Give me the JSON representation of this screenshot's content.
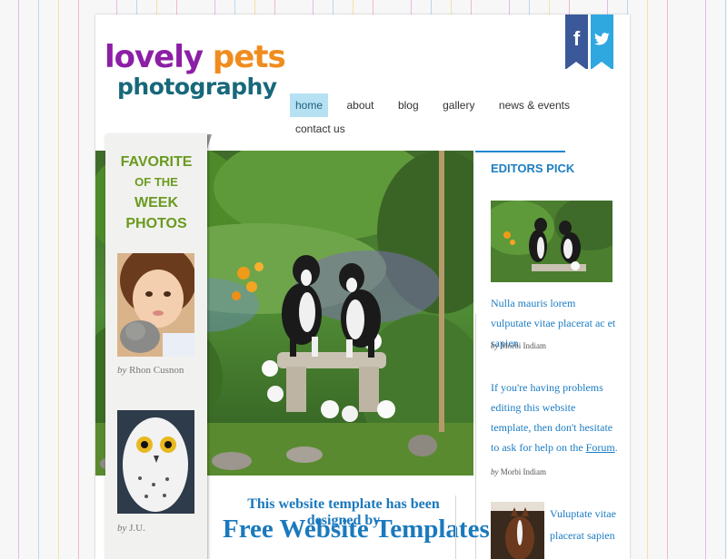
{
  "logo": {
    "word1": "lovely",
    "word2": "pets",
    "line2": "photography"
  },
  "social": {
    "facebook": "f",
    "twitter": "🐦"
  },
  "nav": {
    "items": [
      "home",
      "about",
      "blog",
      "gallery",
      "news & events",
      "contact us"
    ],
    "active": "home"
  },
  "favorites": {
    "title_line1": "FAVORITE",
    "title_line2": "OF THE",
    "title_line3": "WEEK",
    "title_line4": "PHOTOS",
    "photos": [
      {
        "by": "by",
        "name": "Rhon Cusnon"
      },
      {
        "by": "by",
        "name": "J.U."
      }
    ]
  },
  "editors_pick": {
    "title": "EDITORS PICK",
    "item1_text": "Nulla mauris lorem vulputate vitae placerat ac et sapien",
    "item1_by": "by",
    "item1_author": "Morbi Indiam",
    "item2_text": "If you're having problems editing this website template, then don't hesitate to ask for help on the",
    "item2_link": "Forum",
    "item2_after": ".",
    "item2_by": "by",
    "item2_author": "Morbi Indiam",
    "item3_text": "Vuluptate vitae placerat sapien"
  },
  "banner": {
    "line1": "This website template has been designed by",
    "line2": "Free Website Templates"
  },
  "colors": {
    "logo_purple": "#8c1fa5",
    "logo_orange": "#f08c1e",
    "logo_teal": "#17687a",
    "link_blue": "#1b7cc3",
    "fav_green": "#6a9a1f"
  }
}
